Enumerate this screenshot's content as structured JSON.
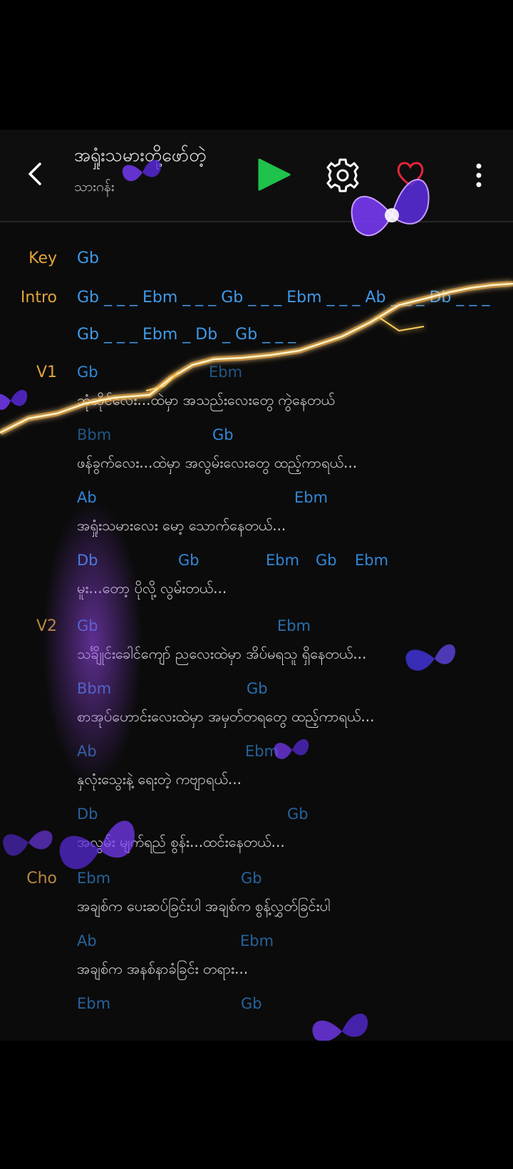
{
  "header": {
    "title": "အရှုံးသမားတို့ဖော်တဲ့",
    "artist": "သားဂန်း"
  },
  "sections": {
    "key": "Key",
    "intro": "Intro",
    "v1": "V1",
    "v2": "V2",
    "cho": "Cho"
  },
  "key_chord": "Gb",
  "intro_lines": [
    "Gb _ _ _ Ebm _ _ _ Gb _ _ _ Ebm _ _ _ Ab _ _ _ Db _ _ _",
    "Gb _ _ _ Ebm _ Db _ Gb _ _ _"
  ],
  "verse1": [
    {
      "chords": [
        "Gb",
        "Ebm"
      ],
      "lyric": "ဘုံဆိုင်လေး...ထဲမှာ အသည်းလေးတွေ ကွဲနေတယ်"
    },
    {
      "chords": [
        "Bbm",
        "Gb"
      ],
      "lyric": "ဖန်ခွက်လေး...ထဲမှာ အလွမ်းလေးတွေ ထည့်ကာရယ်..."
    },
    {
      "chords": [
        "Ab",
        "Ebm"
      ],
      "lyric": "အရှုံးသမားလေး မော့ သောက်နေတယ်..."
    },
    {
      "chords": [
        "Db",
        "Gb",
        "Ebm",
        "Gb",
        "Ebm"
      ],
      "lyric": "မူး...တော့ ပိုလို့ လွမ်းတယ်..."
    }
  ],
  "verse2": [
    {
      "chords": [
        "Gb",
        "Ebm"
      ],
      "lyric": "သင်္ချိုင်းခေါင်ကျော် ညလေးထဲမှာ အိပ်မရသူ ရှိနေတယ်..."
    },
    {
      "chords": [
        "Bbm",
        "Gb"
      ],
      "lyric": "စာအုပ်ဟောင်းလေးထဲမှာ အမှတ်တရတွေ ထည့်ကာရယ်..."
    },
    {
      "chords": [
        "Ab",
        "Ebm"
      ],
      "lyric": "နှလုံးသွေးနဲ့ ရေးတဲ့ ကဗျာရယ်..."
    },
    {
      "chords": [
        "Db",
        "Gb"
      ],
      "lyric": "အလွမ်း မျက်ရည် စွန်း...ထင်းနေတယ်..."
    }
  ],
  "chorus": [
    {
      "chords": [
        "Ebm",
        "Gb"
      ],
      "lyric": "အချစ်က ပေးဆပ်ခြင်းပါ အချစ်က စွန့်လွှတ်ခြင်းပါ"
    },
    {
      "chords": [
        "Ab",
        "Ebm"
      ],
      "lyric": "အချစ်က အနစ်နာခံခြင်း တရား..."
    },
    {
      "chords": [
        "Ebm",
        "Gb"
      ],
      "lyric": ""
    }
  ],
  "icons": {
    "back": "chevron-left-icon",
    "play": "play-icon",
    "settings": "gear-icon",
    "favorite": "heart-icon",
    "more": "more-vertical-icon"
  },
  "colors": {
    "background": "#0b0b0b",
    "section_label": "#e2a33a",
    "chord": "#3f9ae8",
    "lyric": "#d2d2d2",
    "play": "#1fc24a"
  }
}
